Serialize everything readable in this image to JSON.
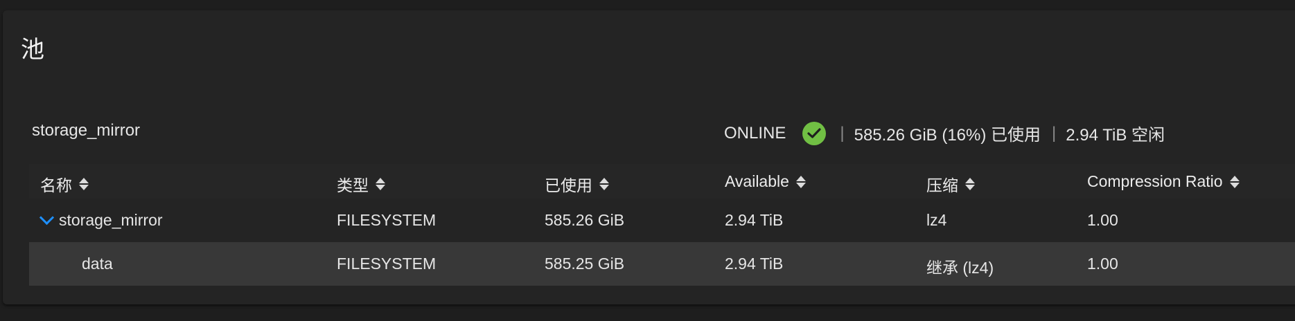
{
  "page": {
    "title": "池"
  },
  "pool": {
    "name": "storage_mirror",
    "status": "ONLINE",
    "status_icon": "check-circle-icon",
    "status_color": "#71bf44",
    "used_text": "585.26 GiB (16%) 已使用",
    "free_text": "2.94 TiB 空闲"
  },
  "table": {
    "headers": [
      "名称",
      "类型",
      "已使用",
      "Available",
      "压缩",
      "Compression Ratio"
    ],
    "rows": [
      {
        "name": "storage_mirror",
        "type": "FILESYSTEM",
        "used": "585.26 GiB",
        "available": "2.94 TiB",
        "compression": "lz4",
        "ratio": "1.00",
        "expanded": true
      },
      {
        "name": "data",
        "type": "FILESYSTEM",
        "used": "585.25 GiB",
        "available": "2.94 TiB",
        "compression": "继承 (lz4)",
        "ratio": "1.00"
      }
    ]
  },
  "colors": {
    "accent": "#1e90ff",
    "background": "#242424"
  }
}
